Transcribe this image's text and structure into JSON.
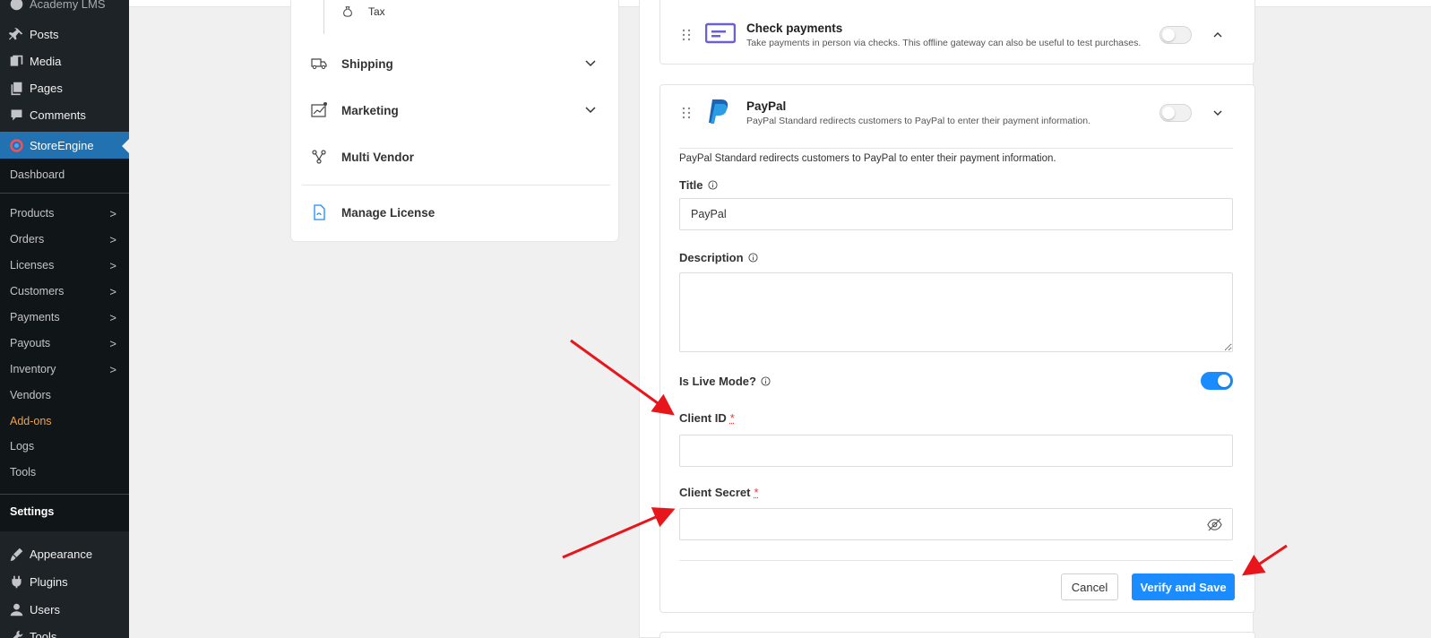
{
  "sidebar": {
    "site_label": "Academy LMS",
    "items": [
      {
        "label": "Posts",
        "icon": "pin-icon"
      },
      {
        "label": "Media",
        "icon": "media-icon"
      },
      {
        "label": "Pages",
        "icon": "pages-icon"
      },
      {
        "label": "Comments",
        "icon": "comment-icon"
      },
      {
        "label": "StoreEngine",
        "icon": "storeengine-logo-icon"
      }
    ],
    "submenu": [
      {
        "label": "Dashboard"
      },
      {
        "label": "Products"
      },
      {
        "label": "Orders"
      },
      {
        "label": "Licenses"
      },
      {
        "label": "Customers"
      },
      {
        "label": "Payments"
      },
      {
        "label": "Payouts"
      },
      {
        "label": "Inventory"
      },
      {
        "label": "Vendors"
      },
      {
        "label": "Add-ons"
      },
      {
        "label": "Logs"
      },
      {
        "label": "Tools"
      },
      {
        "label": "Settings"
      }
    ],
    "bottom_items": [
      {
        "label": "Appearance",
        "icon": "brush-icon"
      },
      {
        "label": "Plugins",
        "icon": "plugin-icon"
      },
      {
        "label": "Users",
        "icon": "users-icon"
      },
      {
        "label": "Tools",
        "icon": "wrench-icon"
      }
    ],
    "chevron": ">"
  },
  "settings_nav": {
    "tax_label": "Tax",
    "shipping_label": "Shipping",
    "marketing_label": "Marketing",
    "multi_vendor_label": "Multi Vendor",
    "manage_license_label": "Manage License"
  },
  "gateways": {
    "check": {
      "name": "Check payments",
      "description": "Take payments in person via checks. This offline gateway can also be useful to test purchases.",
      "enabled": false
    },
    "paypal": {
      "name": "PayPal",
      "description": "PayPal Standard redirects customers to PayPal to enter their payment information.",
      "enabled": false,
      "helper_text": "PayPal Standard redirects customers to PayPal to enter their payment information.",
      "title_label": "Title",
      "title_value": "PayPal",
      "description_label": "Description",
      "description_value": "",
      "live_mode_label": "Is Live Mode?",
      "live_mode": true,
      "client_id_label": "Client ID",
      "client_id_value": "",
      "client_secret_label": "Client Secret",
      "client_secret_value": "",
      "required_mark": "*",
      "cancel_label": "Cancel",
      "save_label": "Verify and Save"
    }
  },
  "colors": {
    "accent": "#1a8cff",
    "wp_active": "#2271b1",
    "annotation_arrow": "#e8161b",
    "addons_highlight": "#f0a14d"
  }
}
